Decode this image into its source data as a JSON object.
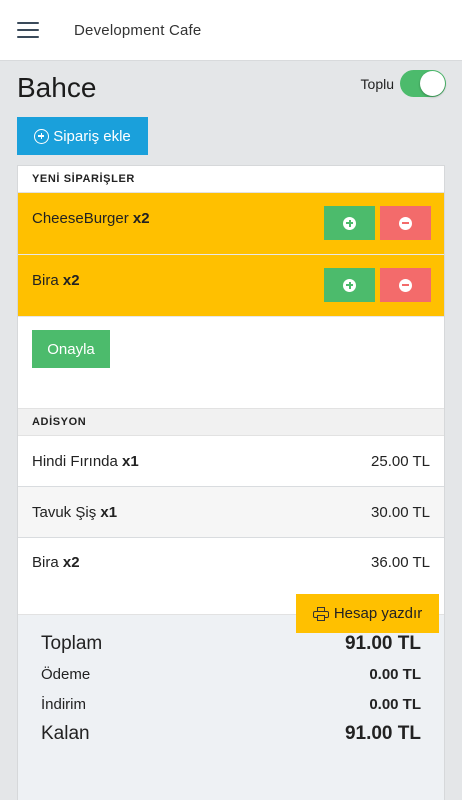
{
  "topbar": {
    "title": "Development Cafe"
  },
  "page": {
    "title": "Bahce"
  },
  "toggle": {
    "label": "Toplu",
    "on": true
  },
  "add_order": {
    "label": "Sipariş ekle"
  },
  "new_orders": {
    "header": "YENİ SİPARİŞLER",
    "items": [
      {
        "name": "CheeseBurger",
        "qty": "x2"
      },
      {
        "name": "Bira",
        "qty": "x2"
      }
    ],
    "confirm_label": "Onayla"
  },
  "bill": {
    "header": "ADİSYON",
    "items": [
      {
        "name": "Hindi Fırında",
        "qty": "x1",
        "price": "25.00 TL"
      },
      {
        "name": "Tavuk Şiş",
        "qty": "x1",
        "price": "30.00 TL"
      },
      {
        "name": "Bira",
        "qty": "x2",
        "price": "36.00 TL"
      }
    ]
  },
  "summary": {
    "total_label": "Toplam",
    "total_value": "91.00 TL",
    "payment_label": "Ödeme",
    "payment_value": "0.00 TL",
    "discount_label": "İndirim",
    "discount_value": "0.00 TL",
    "remaining_label": "Kalan",
    "remaining_value": "91.00 TL"
  },
  "print": {
    "label": "Hesap yazdır"
  },
  "colors": {
    "accent_blue": "#1aa0db",
    "new_order_yellow": "#ffc000",
    "plus_green": "#4cbb6c",
    "minus_red": "#f36b6b"
  }
}
